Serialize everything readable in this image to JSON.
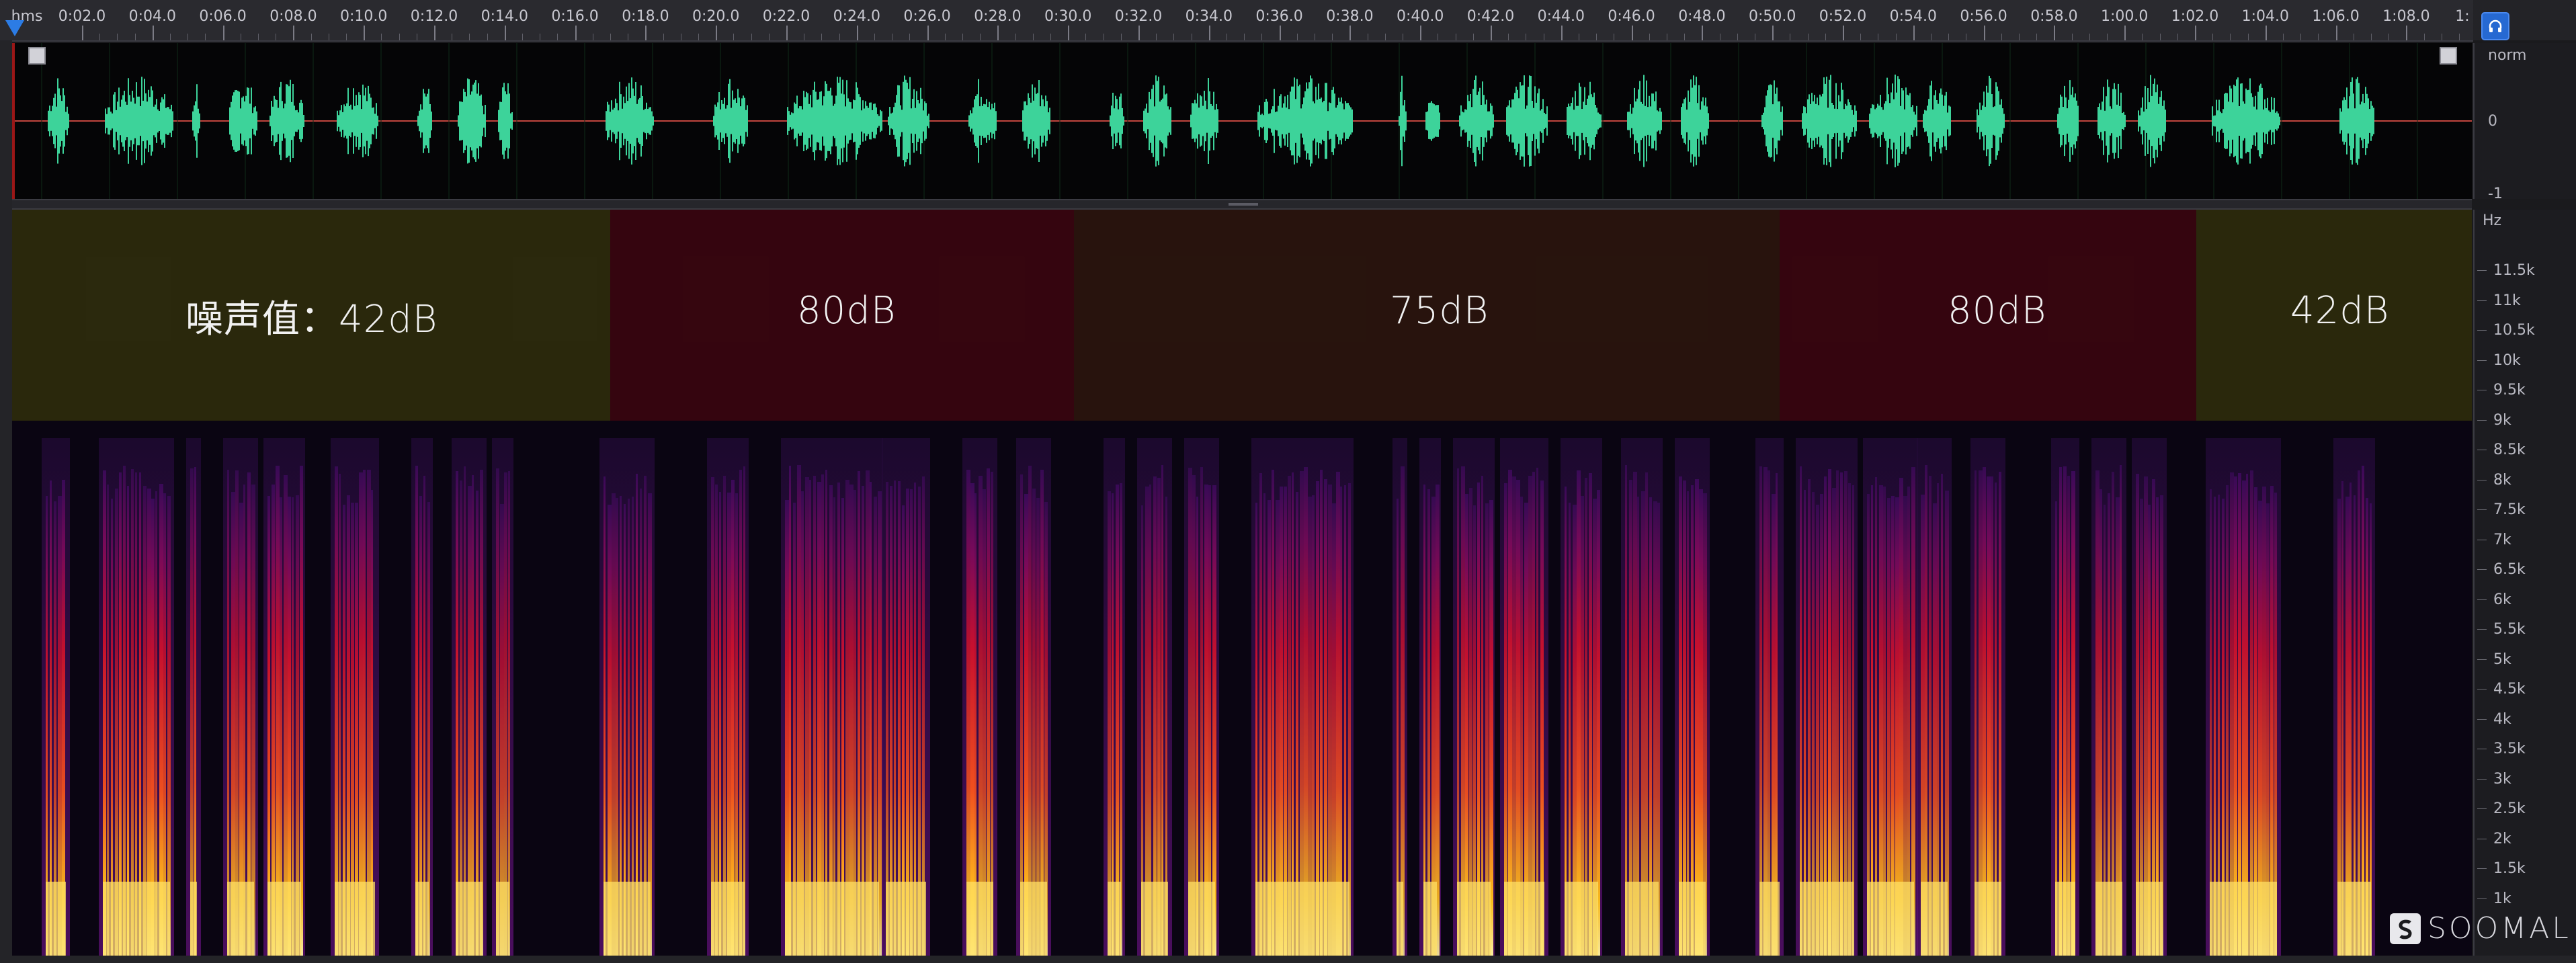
{
  "ruler": {
    "start_label": "hms",
    "ticks": [
      "0:02.0",
      "0:04.0",
      "0:06.0",
      "0:08.0",
      "0:10.0",
      "0:12.0",
      "0:14.0",
      "0:16.0",
      "0:18.0",
      "0:20.0",
      "0:22.0",
      "0:24.0",
      "0:26.0",
      "0:28.0",
      "0:30.0",
      "0:32.0",
      "0:34.0",
      "0:36.0",
      "0:38.0",
      "0:40.0",
      "0:42.0",
      "0:44.0",
      "0:46.0",
      "0:48.0",
      "0:50.0",
      "0:52.0",
      "0:54.0",
      "0:56.0",
      "0:58.0",
      "1:00.0",
      "1:02.0",
      "1:04.0",
      "1:06.0",
      "1:08.0"
    ],
    "end_label": "1:"
  },
  "waveform_scale": {
    "top_label": "norm",
    "mid_label": "0",
    "bottom_label": "-1"
  },
  "noise_bands": [
    {
      "label": "噪声值：42dB",
      "color": "#3a3a06"
    },
    {
      "label": "80dB",
      "color": "#420508"
    },
    {
      "label": "75dB",
      "color": "#3a1c06"
    },
    {
      "label": "80dB",
      "color": "#420508"
    },
    {
      "label": "42dB",
      "color": "#3a3a06"
    }
  ],
  "freq_scale": {
    "unit_label": "Hz",
    "labels": [
      "11.5k",
      "11k",
      "10.5k",
      "10k",
      "9.5k",
      "9k",
      "8.5k",
      "8k",
      "7.5k",
      "7k",
      "6.5k",
      "6k",
      "5.5k",
      "5k",
      "4.5k",
      "4k",
      "3.5k",
      "3k",
      "2.5k",
      "2k",
      "1.5k",
      "1k"
    ]
  },
  "colors": {
    "waveform": "#3dd39a",
    "centerline": "#c0453d",
    "accent": "#2c7ce5"
  },
  "icons": {
    "playhead": "playhead-marker-icon",
    "loop": "headphones-icon",
    "watermark": "sooomal-logo-icon"
  },
  "watermark": {
    "text": "SOOMAL"
  }
}
